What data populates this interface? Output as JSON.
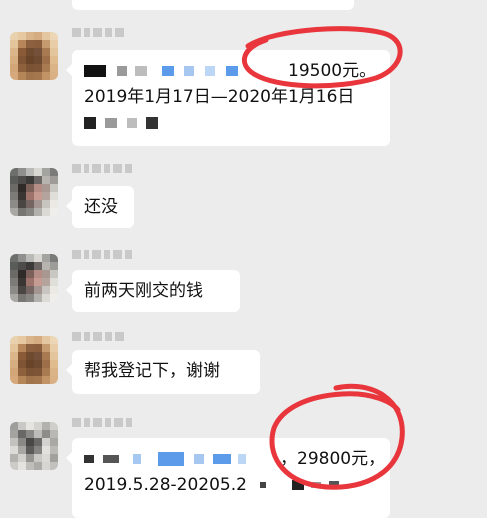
{
  "messages": [
    {
      "amount_text": "19500元。",
      "date_text": "2019年1月17日—2020年1月16日"
    },
    {
      "text": "还没"
    },
    {
      "text": "前两天刚交的钱"
    },
    {
      "text": "帮我登记下，谢谢"
    },
    {
      "amount_text": "，29800元，",
      "date_text": "2019.5.28-20205.2"
    }
  ],
  "colors": {
    "background": "#ececec",
    "bubble": "#ffffff",
    "circle_annotation": "#e8363c",
    "blur_blue": "#5b9bea"
  },
  "icons": {
    "annotation": "red-hand-drawn-circle"
  }
}
